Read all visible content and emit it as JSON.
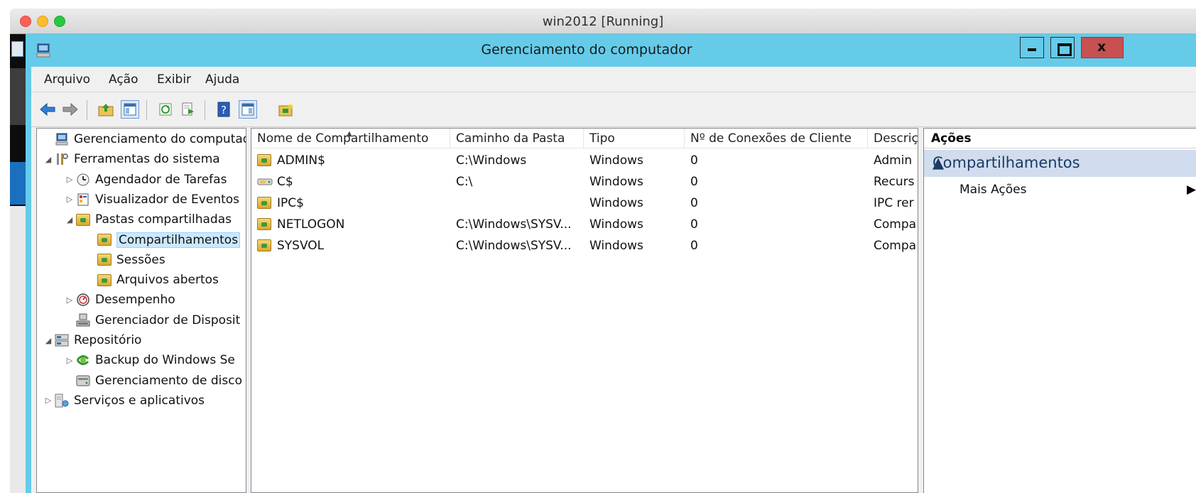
{
  "host": {
    "title": "win2012 [Running]"
  },
  "app": {
    "title": "Gerenciamento do computador",
    "close_glyph": "x"
  },
  "menu": [
    "Arquivo",
    "Ação",
    "Exibir",
    "Ajuda"
  ],
  "toolbar": [
    "back-arrow-icon",
    "forward-arrow-icon",
    "up-folder-icon",
    "show-hide-console-tree-icon",
    "refresh-icon",
    "export-list-icon",
    "help-icon",
    "show-hide-action-pane-icon",
    "new-share-icon"
  ],
  "tree": [
    {
      "label": "Gerenciamento do computado",
      "indent": 0,
      "expander": "",
      "icon": "computer-management-icon"
    },
    {
      "label": "Ferramentas do sistema",
      "indent": 0,
      "expander": "◢",
      "icon": "system-tools-icon"
    },
    {
      "label": "Agendador de Tarefas",
      "indent": 1,
      "expander": "▷",
      "icon": "clock-icon"
    },
    {
      "label": "Visualizador de Eventos",
      "indent": 1,
      "expander": "▷",
      "icon": "event-viewer-icon"
    },
    {
      "label": "Pastas compartilhadas",
      "indent": 1,
      "expander": "◢",
      "icon": "shared-folder-icon"
    },
    {
      "label": "Compartilhamentos",
      "indent": 2,
      "expander": "",
      "icon": "shared-folder-icon",
      "selected": true
    },
    {
      "label": "Sessões",
      "indent": 2,
      "expander": "",
      "icon": "shared-folder-icon"
    },
    {
      "label": "Arquivos abertos",
      "indent": 2,
      "expander": "",
      "icon": "shared-folder-icon"
    },
    {
      "label": "Desempenho",
      "indent": 1,
      "expander": "▷",
      "icon": "performance-icon"
    },
    {
      "label": "Gerenciador de Disposit",
      "indent": 1,
      "expander": "",
      "icon": "device-manager-icon"
    },
    {
      "label": "Repositório",
      "indent": 0,
      "expander": "◢",
      "icon": "storage-icon"
    },
    {
      "label": "Backup do Windows Se",
      "indent": 1,
      "expander": "▷",
      "icon": "backup-icon"
    },
    {
      "label": "Gerenciamento de disco",
      "indent": 1,
      "expander": "",
      "icon": "disk-management-icon"
    },
    {
      "label": "Serviços e aplicativos",
      "indent": 0,
      "expander": "▷",
      "icon": "services-icon"
    }
  ],
  "list": {
    "columns": [
      "Nome de Compartilhamento",
      "Caminho da Pasta",
      "Tipo",
      "Nº de Conexões de Cliente",
      "Descrição"
    ],
    "rows": [
      {
        "name": "ADMIN$",
        "path": "C:\\Windows",
        "type": "Windows",
        "connections": "0",
        "description": "Admin",
        "icon": "shared-folder-icon"
      },
      {
        "name": "C$",
        "path": "C:\\",
        "type": "Windows",
        "connections": "0",
        "description": "Recurs",
        "icon": "shared-drive-icon"
      },
      {
        "name": "IPC$",
        "path": "",
        "type": "Windows",
        "connections": "0",
        "description": "IPC rer",
        "icon": "shared-folder-icon"
      },
      {
        "name": "NETLOGON",
        "path": "C:\\Windows\\SYSV...",
        "type": "Windows",
        "connections": "0",
        "description": "Compa",
        "icon": "shared-folder-icon"
      },
      {
        "name": "SYSVOL",
        "path": "C:\\Windows\\SYSV...",
        "type": "Windows",
        "connections": "0",
        "description": "Compa",
        "icon": "shared-folder-icon"
      }
    ]
  },
  "actions": {
    "header": "Ações",
    "section": "Compartilhamentos",
    "items": [
      "Mais Ações"
    ]
  }
}
